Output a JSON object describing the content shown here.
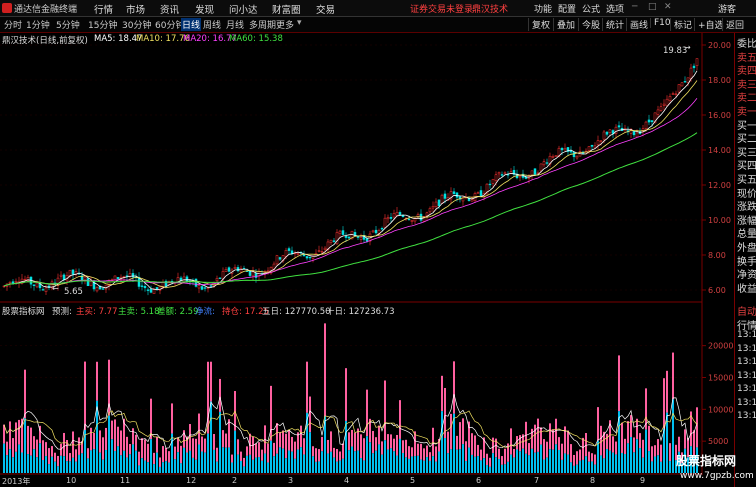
{
  "titlebar": {
    "app_name": "通达信金融终端",
    "menus": [
      "行情",
      "市场",
      "资讯",
      "发现",
      "问小达",
      "财富圈",
      "交易"
    ],
    "notice": "证券交易未登录",
    "stock_name": "鼎汉技术",
    "right": [
      "功能",
      "配置",
      "公式",
      "选项"
    ],
    "user": "游客"
  },
  "toolbar": {
    "periods": [
      "分时",
      "1分钟",
      "5分钟",
      "15分钟",
      "30分钟",
      "60分钟",
      "日线",
      "周线",
      "月线",
      "多周期",
      "更多"
    ],
    "active_period": "日线",
    "right_buttons": [
      "复权",
      "叠加",
      "今股",
      "统计",
      "画线",
      "F10",
      "标记",
      "+自选",
      "返回"
    ]
  },
  "main_legend": {
    "name": "鼎汉技术(日线,前复权)",
    "ma5": "MA5: 18.47",
    "ma10": "MA10: 17.76",
    "ma20": "MA20: 16.77",
    "ma60": "MA60: 15.38"
  },
  "annotations": {
    "high": "19.83",
    "low": "5.65"
  },
  "price_axis": [
    "20.00",
    "18.00",
    "16.00",
    "14.00",
    "12.00",
    "10.00",
    "8.00",
    "6.00"
  ],
  "vol_legend": {
    "name": "股票指标网",
    "pred": "预测:",
    "zhumai": "主买: 7.77",
    "zhumai2": "主卖: 5.18",
    "chae": "差额: 2.59",
    "jingliu": "净流: ",
    "chicang": "持仓: 17.25",
    "wuri": "五日: 127770.50",
    "shiri": "十日: 127236.73"
  },
  "vol_axis": [
    "20000",
    "15000",
    "10000",
    "5000"
  ],
  "date_axis": [
    "2013年",
    "10",
    "11",
    "12",
    "2",
    "3",
    "4",
    "5",
    "6",
    "7",
    "8",
    "9"
  ],
  "right_panel": {
    "top": [
      "委比",
      "卖五",
      "卖四",
      "卖三",
      "卖二",
      "卖一",
      "买一",
      "买二",
      "买三",
      "买四",
      "买五",
      "现价",
      "涨跌",
      "涨幅",
      "总量",
      "外盘",
      "换手",
      "净资",
      "收益"
    ],
    "bottom": [
      "自动",
      "行情",
      "13:11",
      "13:11",
      "13:11",
      "13:11",
      "13:11",
      "13:11",
      "13:11"
    ]
  },
  "watermark": {
    "big": "股票指标网",
    "small": "www.7gpzb.com"
  },
  "colors": {
    "up": "#ff3232",
    "down": "#00e0e0",
    "ma5": "#ffffff",
    "ma10": "#f0e060",
    "ma20": "#ff40ff",
    "ma60": "#40e040",
    "volpink": "#ff60a0",
    "volcyan": "#00c0f0"
  }
}
